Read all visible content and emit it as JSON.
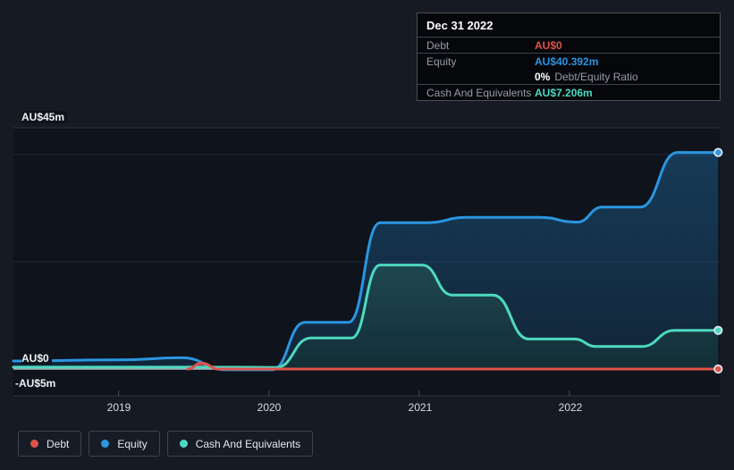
{
  "tooltip": {
    "date": "Dec 31 2022",
    "debt_label": "Debt",
    "debt_value": "AU$0",
    "equity_label": "Equity",
    "equity_value": "AU$40.392m",
    "ratio_bold": "0%",
    "ratio_text": "Debt/Equity Ratio",
    "cash_label": "Cash And Equivalents",
    "cash_value": "AU$7.206m"
  },
  "legend": {
    "items": [
      {
        "id": "debt",
        "label": "Debt",
        "color": "#e0514b"
      },
      {
        "id": "equity",
        "label": "Equity",
        "color": "#2a96e1"
      },
      {
        "id": "cash",
        "label": "Cash And Equivalents",
        "color": "#4dd9c0"
      }
    ]
  },
  "chart_data": {
    "type": "area",
    "title": "Debt / Equity / Cash history",
    "unit": "AU$ millions",
    "x_ticks": [
      "2019",
      "2020",
      "2021",
      "2022"
    ],
    "x_tick_years": [
      2019,
      2020,
      2021,
      2022
    ],
    "y_tick_labels": [
      "AU$45m",
      "AU$0",
      "-AU$5m"
    ],
    "y_gridline_values": [
      45,
      40,
      20,
      0,
      -5
    ],
    "xlim": [
      2018.3,
      2023.0
    ],
    "ylim": [
      -5,
      45
    ],
    "grid": true,
    "legend_position": "bottom-left",
    "end_values": {
      "Debt": 0,
      "Equity": 40.392,
      "Cash And Equivalents": 7.206
    },
    "series": [
      {
        "name": "Equity",
        "color": "#2a96e1",
        "fill_top": "rgba(41,150,225,0.30)",
        "fill_bottom": "rgba(41,150,225,0.14)",
        "points": [
          [
            2018.3,
            1.5
          ],
          [
            2019.0,
            1.7
          ],
          [
            2019.42,
            2.1
          ],
          [
            2019.72,
            -0.15
          ],
          [
            2020.02,
            -0.15
          ],
          [
            2020.24,
            8.7
          ],
          [
            2020.53,
            8.7
          ],
          [
            2020.74,
            27.3
          ],
          [
            2021.05,
            27.3
          ],
          [
            2021.32,
            28.3
          ],
          [
            2021.8,
            28.3
          ],
          [
            2022.05,
            27.4
          ],
          [
            2022.22,
            30.2
          ],
          [
            2022.47,
            30.2
          ],
          [
            2022.72,
            40.392
          ],
          [
            2022.99,
            40.392
          ]
        ]
      },
      {
        "name": "Cash And Equivalents",
        "color": "#4dd9c0",
        "fill_top": "#1f474f",
        "fill_bottom": "#122e37",
        "points": [
          [
            2018.3,
            0.35
          ],
          [
            2019.6,
            0.35
          ],
          [
            2020.05,
            0.3
          ],
          [
            2020.28,
            5.8
          ],
          [
            2020.55,
            5.8
          ],
          [
            2020.74,
            19.4
          ],
          [
            2021.02,
            19.4
          ],
          [
            2021.22,
            13.8
          ],
          [
            2021.49,
            13.8
          ],
          [
            2021.73,
            5.6
          ],
          [
            2022.03,
            5.6
          ],
          [
            2022.18,
            4.2
          ],
          [
            2022.48,
            4.2
          ],
          [
            2022.7,
            7.206
          ],
          [
            2022.99,
            7.206
          ]
        ]
      },
      {
        "name": "Debt",
        "color": "#e0514b",
        "fill_top": "rgba(224,81,75,0.55)",
        "fill_bottom": "rgba(224,81,75,0.55)",
        "points": [
          [
            2019.46,
            0
          ],
          [
            2019.55,
            1.1
          ],
          [
            2019.67,
            0
          ],
          [
            2022.99,
            0
          ]
        ]
      }
    ]
  }
}
